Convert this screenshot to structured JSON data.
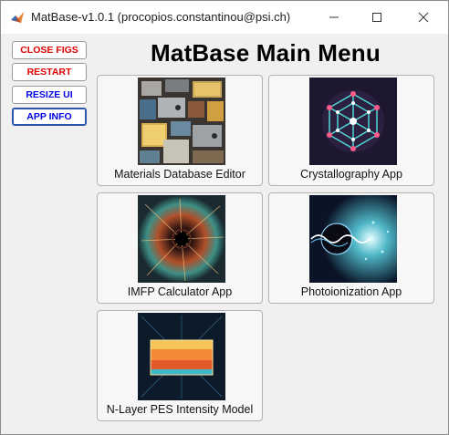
{
  "window": {
    "title": "MatBase-v1.0.1 (procopios.constantinou@psi.ch)",
    "controls": [
      "minimize-icon",
      "maximize-icon",
      "close-icon"
    ]
  },
  "sidebar": {
    "buttons": [
      {
        "label": "CLOSE FIGS",
        "color": "#e00000"
      },
      {
        "label": "RESTART",
        "color": "#e00000"
      },
      {
        "label": "RESIZE UI",
        "color": "#0000e6"
      },
      {
        "label": "APP INFO",
        "color": "#0000e6"
      }
    ]
  },
  "main": {
    "title": "MatBase Main Menu",
    "apps": [
      {
        "label": "Materials Database Editor"
      },
      {
        "label": "Crystallography App"
      },
      {
        "label": "IMFP Calculator App"
      },
      {
        "label": "Photoionization App"
      },
      {
        "label": "N-Layer PES Intensity Model"
      }
    ]
  }
}
